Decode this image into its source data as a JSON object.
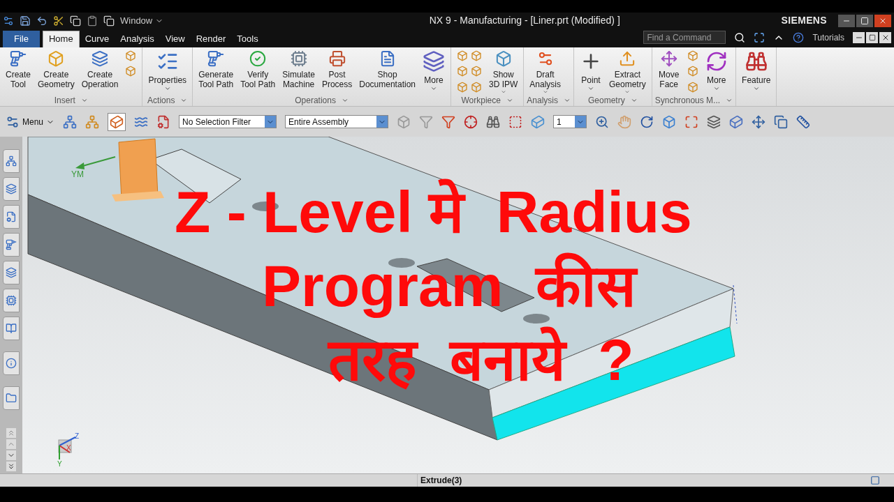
{
  "window": {
    "title": "NX 9 - Manufacturing - [Liner.prt (Modified) ]",
    "brand": "SIEMENS",
    "quick_menu": "Window"
  },
  "tabs": [
    {
      "label": "File",
      "kind": "file",
      "selected": false
    },
    {
      "label": "Home",
      "kind": "tab",
      "selected": true
    },
    {
      "label": "Curve",
      "kind": "tab",
      "selected": false
    },
    {
      "label": "Analysis",
      "kind": "tab",
      "selected": false
    },
    {
      "label": "View",
      "kind": "tab",
      "selected": false
    },
    {
      "label": "Render",
      "kind": "tab",
      "selected": false
    },
    {
      "label": "Tools",
      "kind": "tab",
      "selected": false
    }
  ],
  "search": {
    "placeholder": "Find a Command"
  },
  "help_link": "Tutorials",
  "ribbon_groups": [
    {
      "label": "Insert",
      "items": [
        {
          "kind": "large",
          "lines": [
            "Create",
            "Tool"
          ]
        },
        {
          "kind": "large",
          "lines": [
            "Create",
            "Geometry"
          ]
        },
        {
          "kind": "large",
          "lines": [
            "Create",
            "Operation"
          ]
        },
        {
          "kind": "small"
        },
        {
          "kind": "small"
        }
      ]
    },
    {
      "label": "Actions",
      "items": [
        {
          "kind": "large",
          "lines": [
            "Properties"
          ],
          "menu": true
        }
      ]
    },
    {
      "label": "Operations",
      "items": [
        {
          "kind": "large",
          "lines": [
            "Generate",
            "Tool Path"
          ]
        },
        {
          "kind": "large",
          "lines": [
            "Verify",
            "Tool Path"
          ]
        },
        {
          "kind": "large",
          "lines": [
            "Simulate",
            "Machine"
          ]
        },
        {
          "kind": "large",
          "lines": [
            "Post",
            "Process"
          ]
        },
        {
          "kind": "large",
          "lines": [
            "Shop",
            "Documentation"
          ]
        },
        {
          "kind": "large",
          "lines": [
            "More"
          ],
          "menu": true
        }
      ]
    },
    {
      "label": "Workpiece",
      "items": [
        {
          "kind": "small"
        },
        {
          "kind": "small"
        },
        {
          "kind": "small"
        },
        {
          "kind": "small"
        },
        {
          "kind": "small"
        },
        {
          "kind": "small"
        },
        {
          "kind": "large",
          "lines": [
            "Show",
            "3D IPW"
          ],
          "menu": true
        }
      ]
    },
    {
      "label": "Analysis",
      "items": [
        {
          "kind": "large",
          "lines": [
            "Draft",
            "Analysis"
          ],
          "menu": true
        }
      ]
    },
    {
      "label": "Geometry",
      "items": [
        {
          "kind": "large",
          "lines": [
            "Point"
          ],
          "menu": true
        },
        {
          "kind": "large",
          "lines": [
            "Extract",
            "Geometry"
          ],
          "menu": true
        }
      ]
    },
    {
      "label": "Synchronous M...",
      "items": [
        {
          "kind": "large",
          "lines": [
            "Move",
            "Face"
          ]
        },
        {
          "kind": "small"
        },
        {
          "kind": "small"
        },
        {
          "kind": "small"
        },
        {
          "kind": "large",
          "lines": [
            "More"
          ],
          "menu": true
        }
      ]
    },
    {
      "items": [
        {
          "kind": "large",
          "lines": [
            "Feature"
          ],
          "menu": true
        }
      ]
    }
  ],
  "toolbar": {
    "menu_label": "Menu",
    "selection_filter": "No Selection Filter",
    "assembly_scope": "Entire Assembly",
    "layer": "1"
  },
  "viewport": {
    "work_axis_label": "YM",
    "triad": {
      "z": "Z",
      "x": "X",
      "y": "Y"
    }
  },
  "overlay_caption": [
    "Z - Level मे  Radius",
    "Program  कीस",
    "तरह  बनाये  ?"
  ],
  "status_bar": {
    "text": "Extrude(3)"
  }
}
